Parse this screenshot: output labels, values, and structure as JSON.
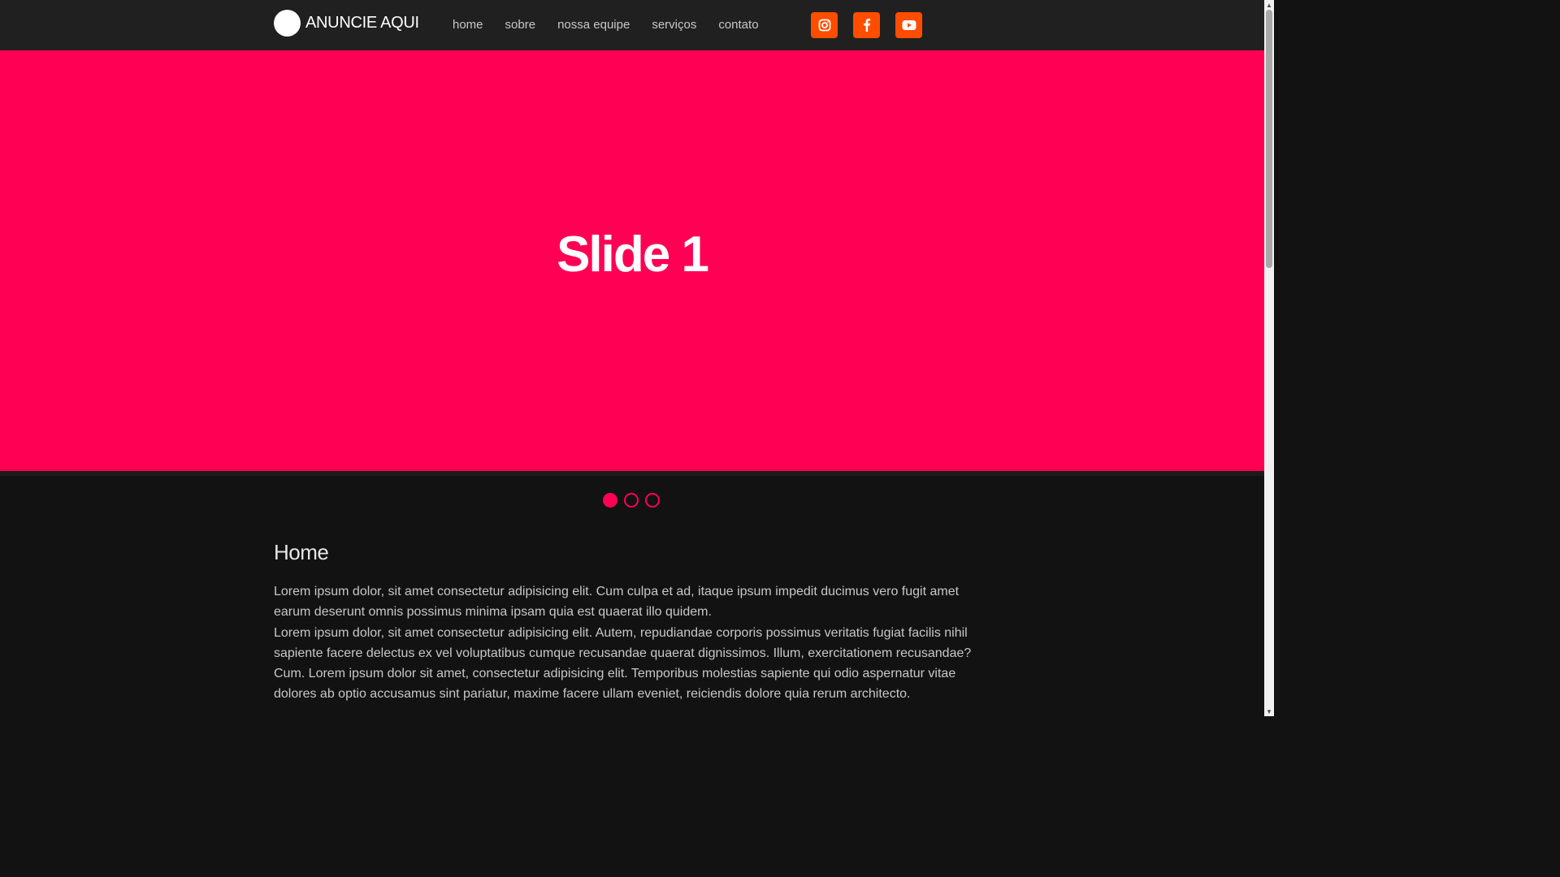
{
  "header": {
    "brand": "ANUNCIE AQUI",
    "nav": [
      "home",
      "sobre",
      "nossa equipe",
      "serviços",
      "contato"
    ],
    "social": [
      {
        "icon": "instagram-icon"
      },
      {
        "icon": "facebook-icon"
      },
      {
        "icon": "youtube-icon"
      }
    ],
    "accent": "#ff4d00"
  },
  "slider": {
    "title": "Slide 1",
    "background": "#ff0055",
    "dots": 3,
    "active_dot": 1
  },
  "content": {
    "title": "Home",
    "paragraphs": [
      "Lorem ipsum dolor, sit amet consectetur adipisicing elit. Cum culpa et ad, itaque ipsum impedit ducimus vero fugit amet earum deserunt omnis possimus minima ipsam quia est quaerat illo quidem.",
      "Lorem ipsum dolor, sit amet consectetur adipisicing elit. Autem, repudiandae corporis possimus veritatis fugiat facilis nihil sapiente facere delectus ex vel voluptatibus cumque recusandae quaerat dignissimos. Illum, exercitationem recusandae? Cum. Lorem ipsum dolor sit amet, consectetur adipisicing elit. Temporibus molestias sapiente qui odio aspernatur vitae dolores ab optio accusamus sint pariatur, maxime facere ullam eveniet, reiciendis dolore quia rerum architecto."
    ]
  }
}
